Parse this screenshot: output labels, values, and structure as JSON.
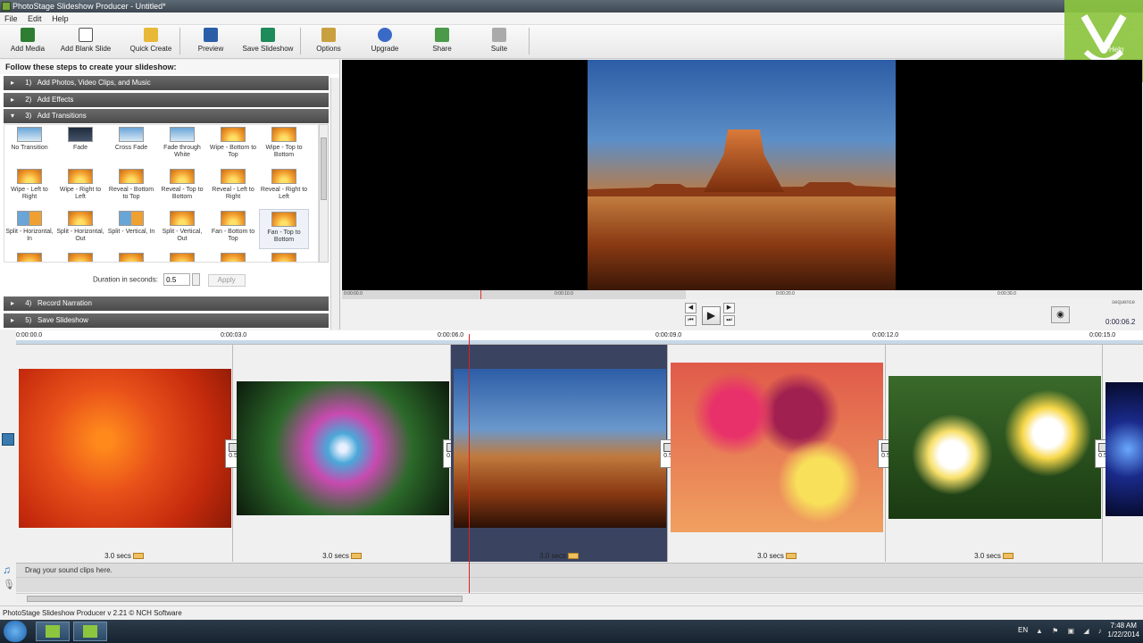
{
  "window": {
    "title": "PhotoStage Slideshow Producer - Untitled*"
  },
  "menu": [
    "File",
    "Edit",
    "Help"
  ],
  "toolbar": [
    {
      "label": "Add Media",
      "icon": "add-media-icon"
    },
    {
      "label": "Add Blank Slide",
      "icon": "blank-slide-icon"
    },
    {
      "label": "Quick Create",
      "icon": "wand-icon"
    },
    {
      "label": "Preview",
      "icon": "preview-icon"
    },
    {
      "label": "Save Slideshow",
      "icon": "save-icon"
    },
    {
      "label": "Options",
      "icon": "options-icon"
    },
    {
      "label": "Upgrade",
      "icon": "globe-icon"
    },
    {
      "label": "Share",
      "icon": "share-icon"
    },
    {
      "label": "Suite",
      "icon": "suite-icon"
    }
  ],
  "help_label": "Help",
  "steps": {
    "header": "Follow these steps to create your slideshow:",
    "items": [
      {
        "num": "1)",
        "label": "Add Photos, Video Clips, and Music",
        "arrow": "▸"
      },
      {
        "num": "2)",
        "label": "Add Effects",
        "arrow": "▸"
      },
      {
        "num": "3)",
        "label": "Add Transitions",
        "arrow": "▾"
      },
      {
        "num": "4)",
        "label": "Record Narration",
        "arrow": "▸"
      },
      {
        "num": "5)",
        "label": "Save Slideshow",
        "arrow": "▸"
      }
    ]
  },
  "transitions": [
    {
      "label": "No Transition",
      "thumb": "sky"
    },
    {
      "label": "Fade",
      "thumb": "dark"
    },
    {
      "label": "Cross Fade",
      "thumb": "sky"
    },
    {
      "label": "Fade through White",
      "thumb": "sky"
    },
    {
      "label": "Wipe - Bottom to Top",
      "thumb": "sun"
    },
    {
      "label": "Wipe - Top to Bottom",
      "thumb": "sun"
    },
    {
      "label": "Wipe - Left to Right",
      "thumb": "sun"
    },
    {
      "label": "Wipe - Right to Left",
      "thumb": "sun"
    },
    {
      "label": "Reveal - Bottom to Top",
      "thumb": "sun"
    },
    {
      "label": "Reveal - Top to Bottom",
      "thumb": "sun"
    },
    {
      "label": "Reveal - Left to Right",
      "thumb": "sun"
    },
    {
      "label": "Reveal - Right to Left",
      "thumb": "sun"
    },
    {
      "label": "Split - Horizontal, In",
      "thumb": "mix"
    },
    {
      "label": "Split - Horizontal, Out",
      "thumb": "sun"
    },
    {
      "label": "Split - Vertical, In",
      "thumb": "mix"
    },
    {
      "label": "Split - Vertical, Out",
      "thumb": "sun"
    },
    {
      "label": "Fan - Bottom to Top",
      "thumb": "sun"
    },
    {
      "label": "Fan - Top to Bottom",
      "thumb": "sun"
    },
    {
      "label": "",
      "thumb": "sun"
    },
    {
      "label": "",
      "thumb": "sun"
    },
    {
      "label": "",
      "thumb": "sun"
    },
    {
      "label": "",
      "thumb": "sun"
    },
    {
      "label": "",
      "thumb": "sun"
    },
    {
      "label": "",
      "thumb": "sun"
    }
  ],
  "duration": {
    "label": "Duration in seconds:",
    "value": "0.5",
    "apply": "Apply"
  },
  "preview_ruler": [
    "0:00:00.0",
    "0:00:10.0",
    "0:00:20.0",
    "0:00:30.0"
  ],
  "sequence_label": "sequence",
  "time_readout": "0:00:06.2",
  "timeline_ruler": [
    "0:00:00.0",
    "0:00:03.0",
    "0:00:06.0",
    "0:00:09.0",
    "0:00:12.0",
    "0:00:15.0"
  ],
  "clips": [
    {
      "name": "orange-flower",
      "duration": "3.0 secs",
      "transition": "0.5",
      "selected": false
    },
    {
      "name": "fractal-flower",
      "duration": "3.0 secs",
      "transition": "0.5",
      "selected": false
    },
    {
      "name": "desert-butte",
      "duration": "3.0 secs",
      "transition": "0.5",
      "selected": true
    },
    {
      "name": "roses",
      "duration": "3.0 secs",
      "transition": "0.5",
      "selected": false
    },
    {
      "name": "plumeria",
      "duration": "3.0 secs",
      "transition": "0.5",
      "selected": false
    }
  ],
  "sound_track": "Drag your sound clips here.",
  "statusbar": "PhotoStage Slideshow Producer v 2.21 © NCH Software",
  "taskbar": {
    "lang": "EN",
    "time": "7:48 AM",
    "date": "1/22/2014"
  }
}
